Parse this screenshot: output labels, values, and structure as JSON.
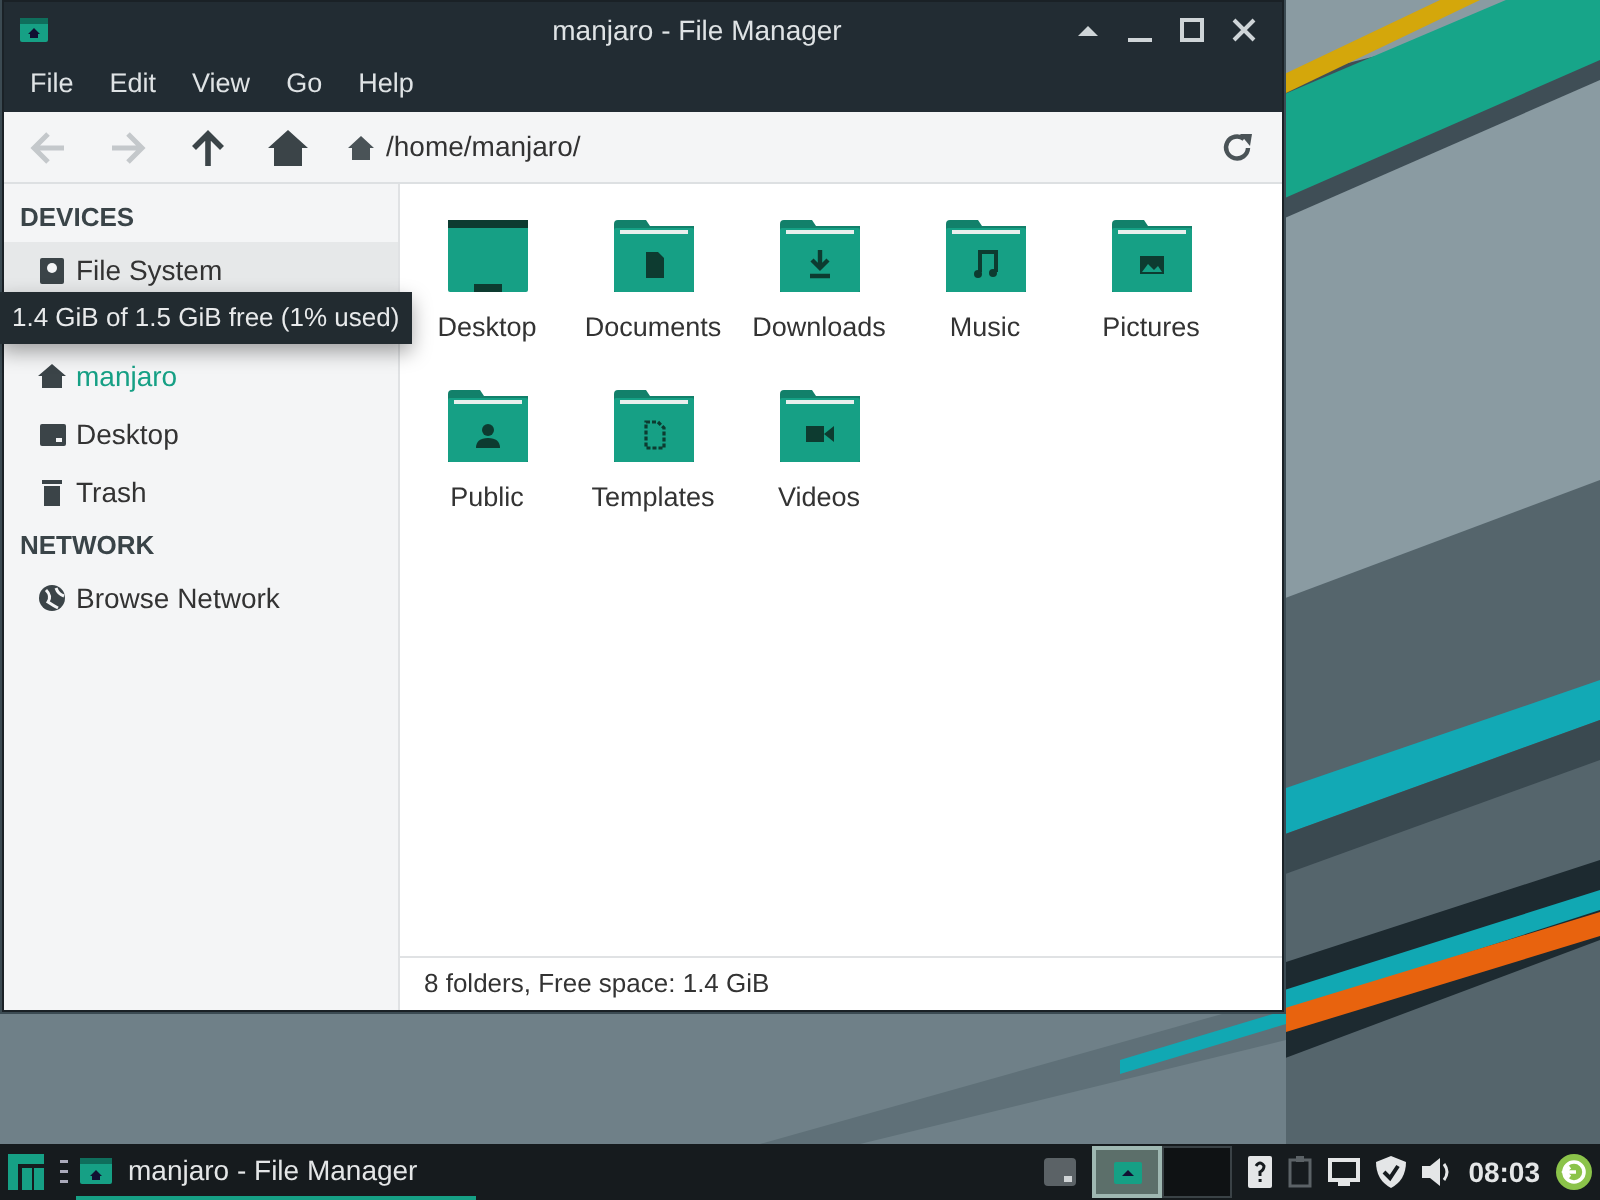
{
  "window": {
    "title": "manjaro - File Manager"
  },
  "menu": [
    "File",
    "Edit",
    "View",
    "Go",
    "Help"
  ],
  "toolbar": {
    "back_disabled": true,
    "forward_disabled": true,
    "location": "/home/manjaro/"
  },
  "sidebar": [
    {
      "heading": "DEVICES",
      "items": [
        {
          "kind": "drive",
          "label": "File System",
          "selected": false,
          "hovered": true
        }
      ]
    },
    {
      "items": [
        {
          "kind": "home",
          "label": "manjaro",
          "selected": true,
          "hovered": false
        },
        {
          "kind": "desktop",
          "label": "Desktop",
          "selected": false,
          "hovered": false
        },
        {
          "kind": "trash",
          "label": "Trash",
          "selected": false,
          "hovered": false
        }
      ]
    },
    {
      "heading": "NETWORK",
      "items": [
        {
          "kind": "network",
          "label": "Browse Network",
          "selected": false,
          "hovered": false
        }
      ]
    }
  ],
  "tooltip": "1.4 GiB of 1.5 GiB free (1% used)",
  "folders": [
    {
      "kind": "desktop",
      "label": "Desktop"
    },
    {
      "kind": "documents",
      "label": "Documents"
    },
    {
      "kind": "downloads",
      "label": "Downloads"
    },
    {
      "kind": "music",
      "label": "Music"
    },
    {
      "kind": "pictures",
      "label": "Pictures"
    },
    {
      "kind": "public",
      "label": "Public"
    },
    {
      "kind": "templates",
      "label": "Templates"
    },
    {
      "kind": "videos",
      "label": "Videos"
    }
  ],
  "status_bar": "8 folders, Free space: 1.4 GiB",
  "taskbar": {
    "task": {
      "title": "manjaro - File Manager",
      "selected": true
    },
    "workspaces": [
      {
        "selected": true
      },
      {
        "selected": false
      }
    ],
    "clock": "08:03"
  }
}
